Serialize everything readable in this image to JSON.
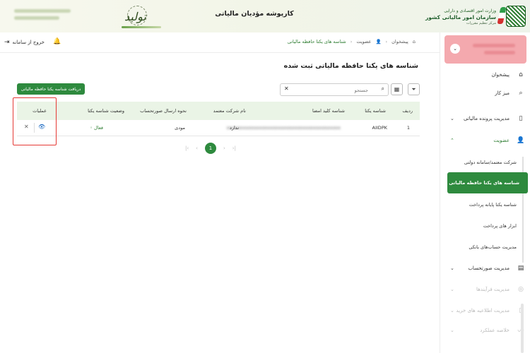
{
  "header": {
    "org_line1": "وزارت امور اقتصادی و دارایی",
    "org_line2": "سازمان امور مالیاتی کشور",
    "org_line3": "مرکز تنظیم مقررات",
    "app_title": "کارپوشه مؤدیان مالیاتی",
    "slogan": "تولید"
  },
  "topbar": {
    "exit_label": "خروج از سامانه",
    "breadcrumb": [
      "پیشخوان",
      "عضویت",
      "شناسه های یکتا حافظه مالیاتی"
    ]
  },
  "sidebar": {
    "items": [
      {
        "label": "پیشخوان",
        "icon": "home-icon"
      },
      {
        "label": "میز کار",
        "icon": "search-icon"
      },
      {
        "label": "مدیریت پرونده مالیاتی",
        "icon": "document-icon"
      },
      {
        "label": "عضویت",
        "icon": "user-icon"
      }
    ],
    "sub_items": [
      "شرکت معتمد/سامانه دولتی",
      "شناسه های یکتا حافظه مالیاتی",
      "شناسه یکتا پایانه پرداخت",
      "ابزار های پرداخت",
      "مدیریت حساب‌های بانکی"
    ],
    "lower_items": [
      {
        "label": "مدیریت صورتحساب",
        "icon": "invoice-icon"
      },
      {
        "label": "مدیریت فرآیندها",
        "icon": "process-icon"
      },
      {
        "label": "مدیریت اطلاعیه های خرید",
        "icon": "notice-icon"
      },
      {
        "label": "خلاصه عملکرد",
        "icon": "summary-icon"
      }
    ]
  },
  "main": {
    "title": "شناسه های یکتا حافظه مالیاتی ثبت شده",
    "get_button": "دریافت شناسه یکتا حافظه مالیاتی",
    "search_placeholder": "جستجو",
    "columns": [
      "ردیف",
      "شناسه یکتا",
      "شناسه کلید امضا",
      "نام شرکت معتمد",
      "نحوه ارسال صورتحساب",
      "وضعیت شناسه یکتا",
      "عملیات"
    ],
    "rows": [
      {
        "row_no": "1",
        "unique_id": "AIIDPK",
        "signing_key_id": "xxxxxxxxxxxxxxxxxxxxxxxxxxxxxxxxxxxxxxxxxx",
        "trusted_company": "ندارد",
        "send_method": "مودی",
        "status": "فعال"
      }
    ],
    "pager": {
      "current": "1"
    }
  }
}
